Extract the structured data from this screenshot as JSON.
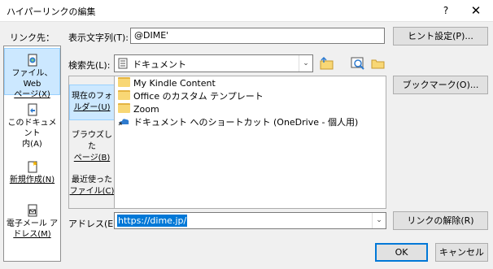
{
  "window": {
    "title": "ハイパーリンクの編集",
    "help_label": "?",
    "close_label": "✕"
  },
  "link_target": {
    "label": "リンク先：",
    "items": [
      {
        "label_line1": "ファイル、Web",
        "label_line2": "ページ(X)",
        "icon": "file-web-icon"
      },
      {
        "label_line1": "このドキュメント",
        "label_line2": "内(A)",
        "icon": "document-icon"
      },
      {
        "label_line1": "新規作成(N)",
        "label_line2": "",
        "icon": "new-document-icon"
      },
      {
        "label_line1": "電子メール ア",
        "label_line2": "ドレス(M)",
        "icon": "email-icon"
      }
    ]
  },
  "display_text": {
    "label": "表示文字列(T):",
    "value": "@DIME'"
  },
  "screen_tip_button": "ヒント設定(P)...",
  "search_in": {
    "label": "検索先(L):",
    "value": "ドキュメント"
  },
  "side_tabs": [
    {
      "line1": "現在のフォ",
      "line2": "ルダー(U)"
    },
    {
      "line1": "ブラウズした",
      "line2": "ページ(B)"
    },
    {
      "line1": "最近使った",
      "line2": "ファイル(C)"
    }
  ],
  "files": [
    {
      "name": "My Kindle Content",
      "icon": "folder-icon"
    },
    {
      "name": "Office のカスタム テンプレート",
      "icon": "folder-icon"
    },
    {
      "name": "Zoom",
      "icon": "folder-icon"
    },
    {
      "name": "ドキュメント へのショートカット (OneDrive - 個人用)",
      "icon": "onedrive-shortcut-icon"
    }
  ],
  "bookmark_button": "ブックマーク(O)...",
  "address": {
    "label": "アドレス(E):",
    "value": "https://dime.jp/"
  },
  "remove_link_button": "リンクの解除(R)",
  "ok_button": "OK",
  "cancel_button": "キャンセル",
  "colors": {
    "selection": "#cce8ff",
    "selection_border": "#99d1ff",
    "dialog_bg": "#f0f0f0",
    "address_highlight": "#0078d7"
  }
}
